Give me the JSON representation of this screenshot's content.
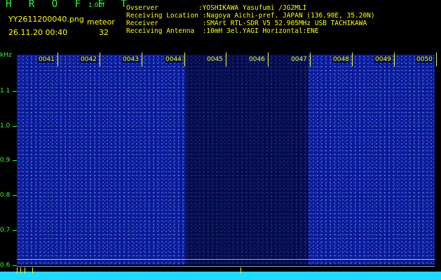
{
  "header": {
    "title": "H R O F F T",
    "version": "1.00f",
    "filename": "YY2611200040.png",
    "datetime": "26.11.20 00:40",
    "event_label": "meteor",
    "event_count": "32",
    "observer_line": "Ovserver          :YOSHIKAWA Yasufumi /JG2MLI",
    "location_line": "Receiving Location :Nagoya Aichi-pref. JAPAN (136.90E, 35.20N)",
    "receiver_line": "Receiver           :SMArt RTL-SDR V5 52.905MHz USB TACHIKAWA",
    "antenna_line": "Receiving Antenna  :10mH 3el.YAGI Horizontal:ENE"
  },
  "axis": {
    "y_unit": "kHz",
    "y_ticks": [
      "1.1",
      "1.0",
      "0.9",
      "0.8",
      "0.7",
      "0.6"
    ],
    "x_ticks": [
      "0041",
      "0042",
      "0043",
      "0044",
      "0045",
      "0046",
      "0047",
      "0048",
      "0049",
      "0050"
    ]
  },
  "colors": {
    "background": "#000000",
    "waterfall": "#0a1a9a",
    "axis_text": "#33ff33",
    "label_text": "#ffff00",
    "baseline": "#22d8ff"
  }
}
